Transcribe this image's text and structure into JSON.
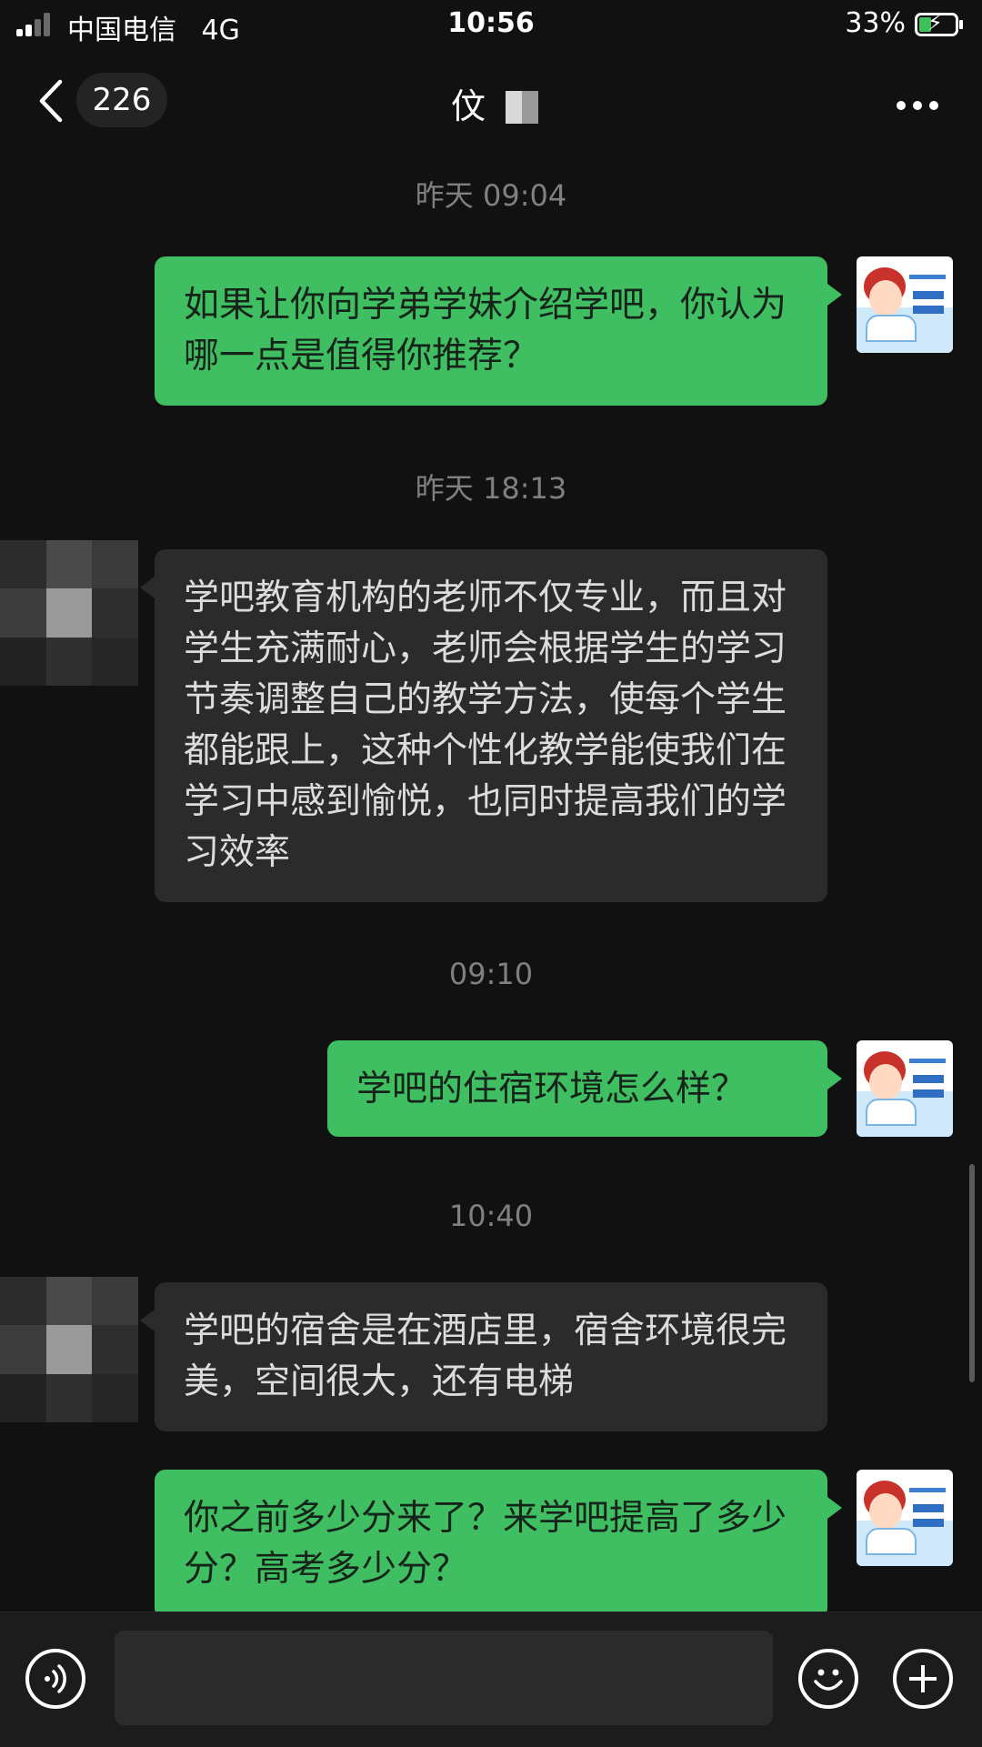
{
  "status_bar": {
    "carrier": "中国电信",
    "network": "4G",
    "time": "10:56",
    "battery_percent": "33%",
    "battery_level": 0.33,
    "charging": true,
    "colors": {
      "battery_fill": "#3fc15a"
    }
  },
  "nav": {
    "unread_count": "226",
    "contact_name": "伩"
  },
  "messages": [
    {
      "type": "timestamp",
      "text": "昨天 09:04"
    },
    {
      "type": "outgoing",
      "text": "如果让你向学弟学妹介绍学吧，你认为哪一点是值得你推荐？"
    },
    {
      "type": "timestamp",
      "text": "昨天 18:13"
    },
    {
      "type": "incoming",
      "text": "学吧教育机构的老师不仅专业，而且对学生充满耐心，老师会根据学生的学习节奏调整自己的教学方法，使每个学生都能跟上，这种个性化教学能使我们在学习中感到愉悦，也同时提高我们的学习效率"
    },
    {
      "type": "timestamp",
      "text": "09:10"
    },
    {
      "type": "outgoing",
      "text": "学吧的住宿环境怎么样？"
    },
    {
      "type": "timestamp",
      "text": "10:40"
    },
    {
      "type": "incoming",
      "text": "学吧的宿舍是在酒店里，宿舍环境很完美，空间很大，还有电梯"
    },
    {
      "type": "outgoing",
      "text": "你之前多少分来了？来学吧提高了多少分？高考多少分？"
    }
  ],
  "icons": {
    "back": "chevron-left-icon",
    "more": "more-dots-icon",
    "voice": "voice-icon",
    "emoji": "emoji-icon",
    "add": "plus-icon"
  },
  "input": {
    "value": "",
    "placeholder": ""
  },
  "colors": {
    "background": "#111111",
    "outgoing_bubble": "#3fbf61",
    "incoming_bubble": "#2b2b2b",
    "timestamp_text": "#808080"
  }
}
